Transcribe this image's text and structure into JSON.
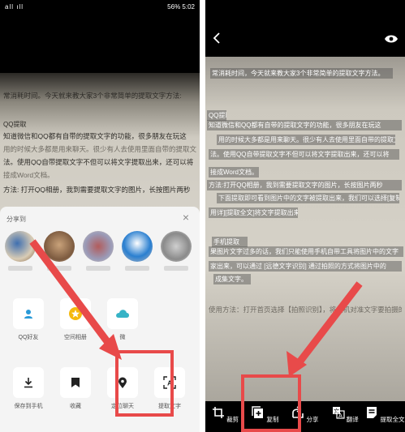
{
  "left_screen": {
    "status": {
      "signal": "all ıll",
      "battery_text": "56%",
      "time": "5:02"
    },
    "background_text": [
      "常消耗时间。今天就来教大家3个非常简单的提取文字方法:",
      "QQ提取",
      "知道微信和QQ都有自带的提取文字的功能，很多朋友在玩这",
      "用的时候大多都是用来聊天。很少有人去使用里面自带的提取文",
      "法。使用QQ自带提取文字不但可以将文字提取出来，还可以将",
      "接成Word文档。",
      "方法: 打开QQ相册，我到需要提取文字的图片，长按图片两秒"
    ],
    "share_sheet": {
      "title": "分享到",
      "tiles_row1": [
        {
          "label": "QQ好友",
          "icon": "person-icon"
        },
        {
          "label": "空间相册",
          "icon": "star-icon"
        },
        {
          "label": "微",
          "icon": "cloud-icon"
        }
      ],
      "tiles_row2": [
        {
          "label": "保存到手机",
          "icon": "download-icon"
        },
        {
          "label": "收藏",
          "icon": "bookmark-icon"
        },
        {
          "label": "定位聊天",
          "icon": "location-icon"
        },
        {
          "label": "提取文字",
          "icon": "ocr-icon"
        }
      ]
    },
    "accent": "#e84a4a"
  },
  "right_screen": {
    "highlight_lines": [
      "常消耗时间，今天就来教大家3个非常简单的提取文字方法。",
      "QQ提取",
      "知道微信和QQ都有自带的提取文字的功能，很多朋友在玩这",
      "用的时候大多都是用来聊天。很少有人去使用里面自带的提取文",
      "法。使用QQ自带提取文字不但可以将文字提取出来，还可以将",
      "接成Word文档。",
      "方法:打开QQ相册，我到需要提取文字的图片，长按图片两秒",
      "下面提取即可看到图片中的文字被提取出来，我们可以选择[复制",
      "用详][提取全文]将文字提取出来。",
      "手机提取",
      "果图片文字过多的话，我们只能使用手机自带工具将图片中的文字",
      "家出来，可以通过 [远德文字识别] 通过拍照的方式将图片中的",
      "成集文字。",
      "使用方法：打开首页选择【拍照识别】，将相机对准文字要拍摄的"
    ],
    "toolbar": [
      {
        "label": "裁剪",
        "icon": "crop-icon"
      },
      {
        "label": "复制",
        "icon": "copy-icon"
      },
      {
        "label": "分享",
        "icon": "share-icon"
      },
      {
        "label": "翻译",
        "icon": "translate-icon"
      },
      {
        "label": "提取全文",
        "icon": "extract-all-icon"
      }
    ]
  }
}
